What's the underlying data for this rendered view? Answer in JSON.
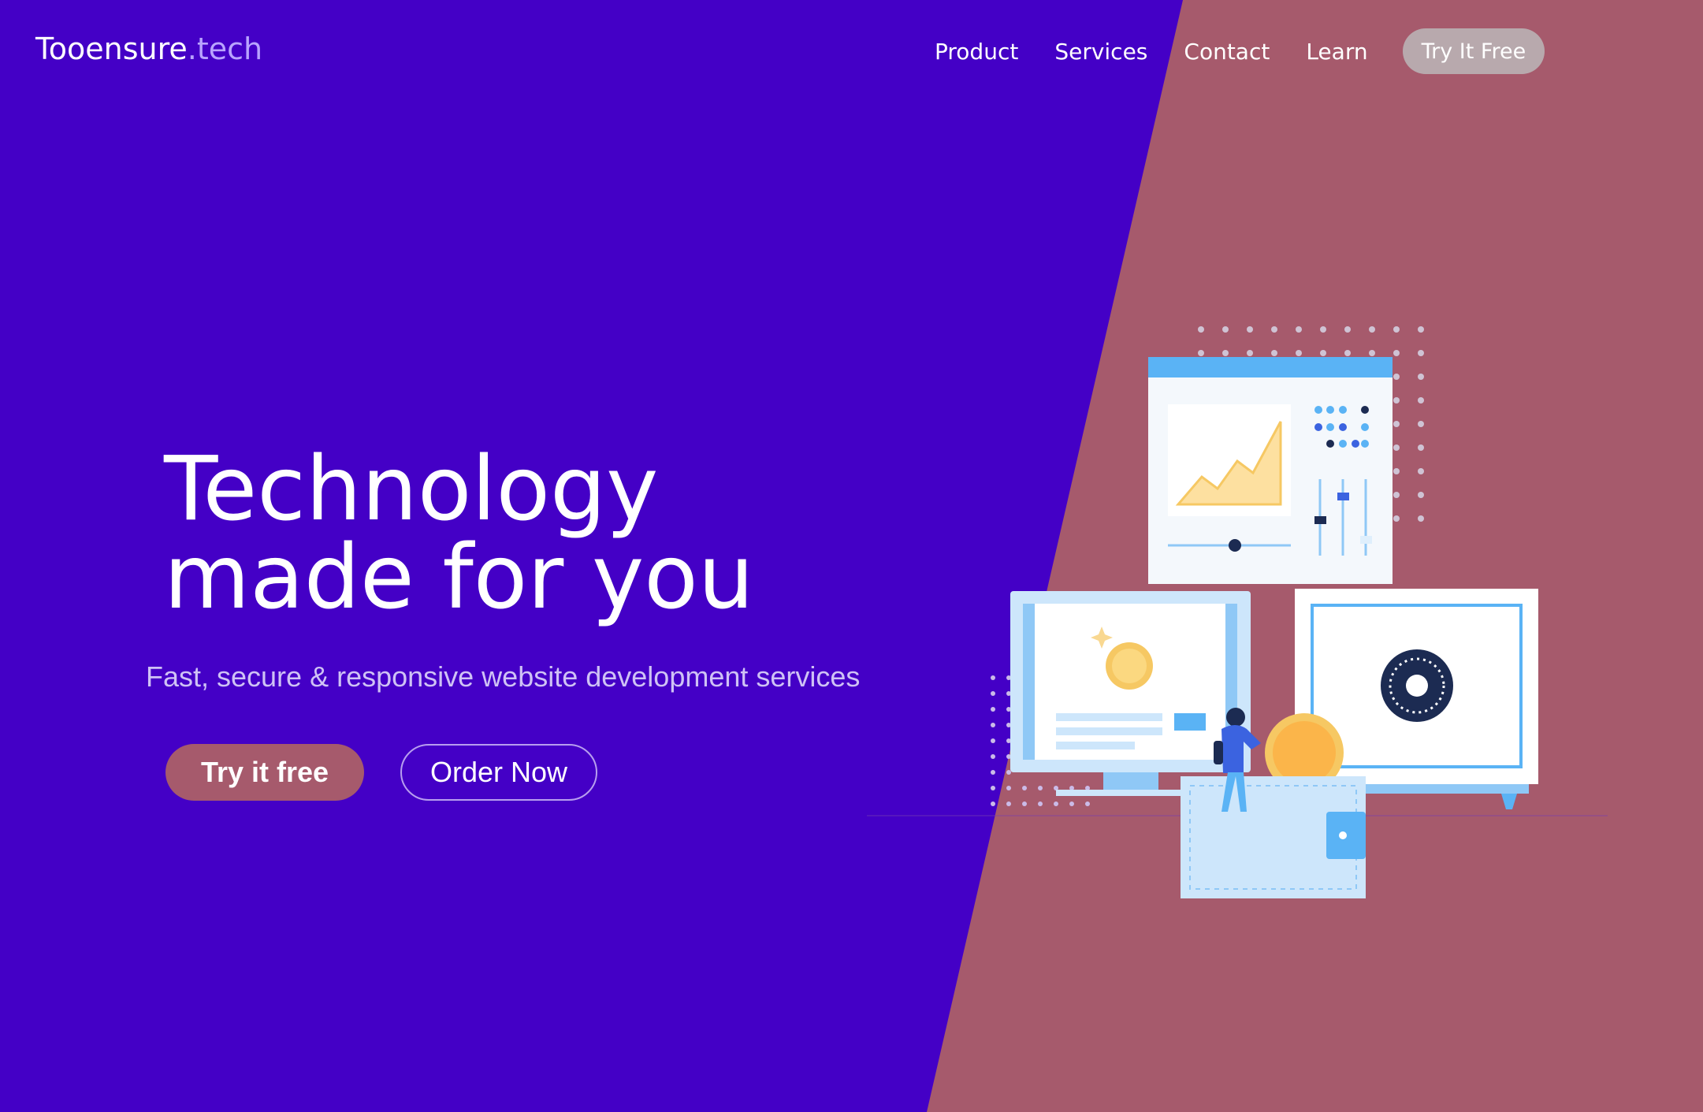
{
  "brand": {
    "name": "Tooensure",
    "suffix": ".tech"
  },
  "nav": {
    "items": [
      "Product",
      "Services",
      "Contact",
      "Learn"
    ],
    "cta": "Try It Free"
  },
  "hero": {
    "title_line1": "Technology",
    "title_line2": "made for you",
    "subtitle": "Fast, secure & responsive website development services",
    "primary_button": "Try it free",
    "secondary_button": "Order Now"
  },
  "colors": {
    "left_background": "#4400c6",
    "right_background": "#a65a6c",
    "accent_light": "#b9a4ff",
    "cta_gray": "#b8a9ad"
  },
  "illustration": {
    "icons": [
      "chart-window-icon",
      "coin-monitor-icon",
      "safe-icon",
      "wallet-icon",
      "person-icon",
      "coin-icon"
    ]
  }
}
